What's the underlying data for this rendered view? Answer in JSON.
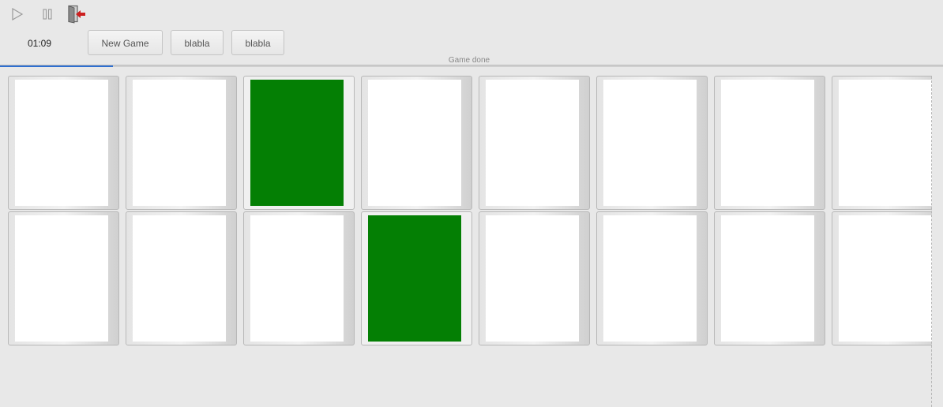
{
  "toolbar": {
    "icons": [
      "play-icon",
      "pause-icon",
      "exit-icon"
    ],
    "exit_icon_color": "#cc1f1f"
  },
  "controls": {
    "timer": "01:09",
    "new_game_label": "New Game",
    "button2_label": "blabla",
    "button3_label": "blabla"
  },
  "status": {
    "label": "Game done",
    "progress_fraction": 0.12,
    "progress_color": "#2f6fd0"
  },
  "board": {
    "rows": 2,
    "columns": 8,
    "face_down_color": "#ffffff",
    "revealed_color": "#047f04",
    "cards": [
      {
        "revealed": false
      },
      {
        "revealed": false
      },
      {
        "revealed": true
      },
      {
        "revealed": false
      },
      {
        "revealed": false
      },
      {
        "revealed": false
      },
      {
        "revealed": false
      },
      {
        "revealed": false
      },
      {
        "revealed": false
      },
      {
        "revealed": false
      },
      {
        "revealed": false
      },
      {
        "revealed": true
      },
      {
        "revealed": false
      },
      {
        "revealed": false
      },
      {
        "revealed": false
      },
      {
        "revealed": false
      }
    ]
  }
}
